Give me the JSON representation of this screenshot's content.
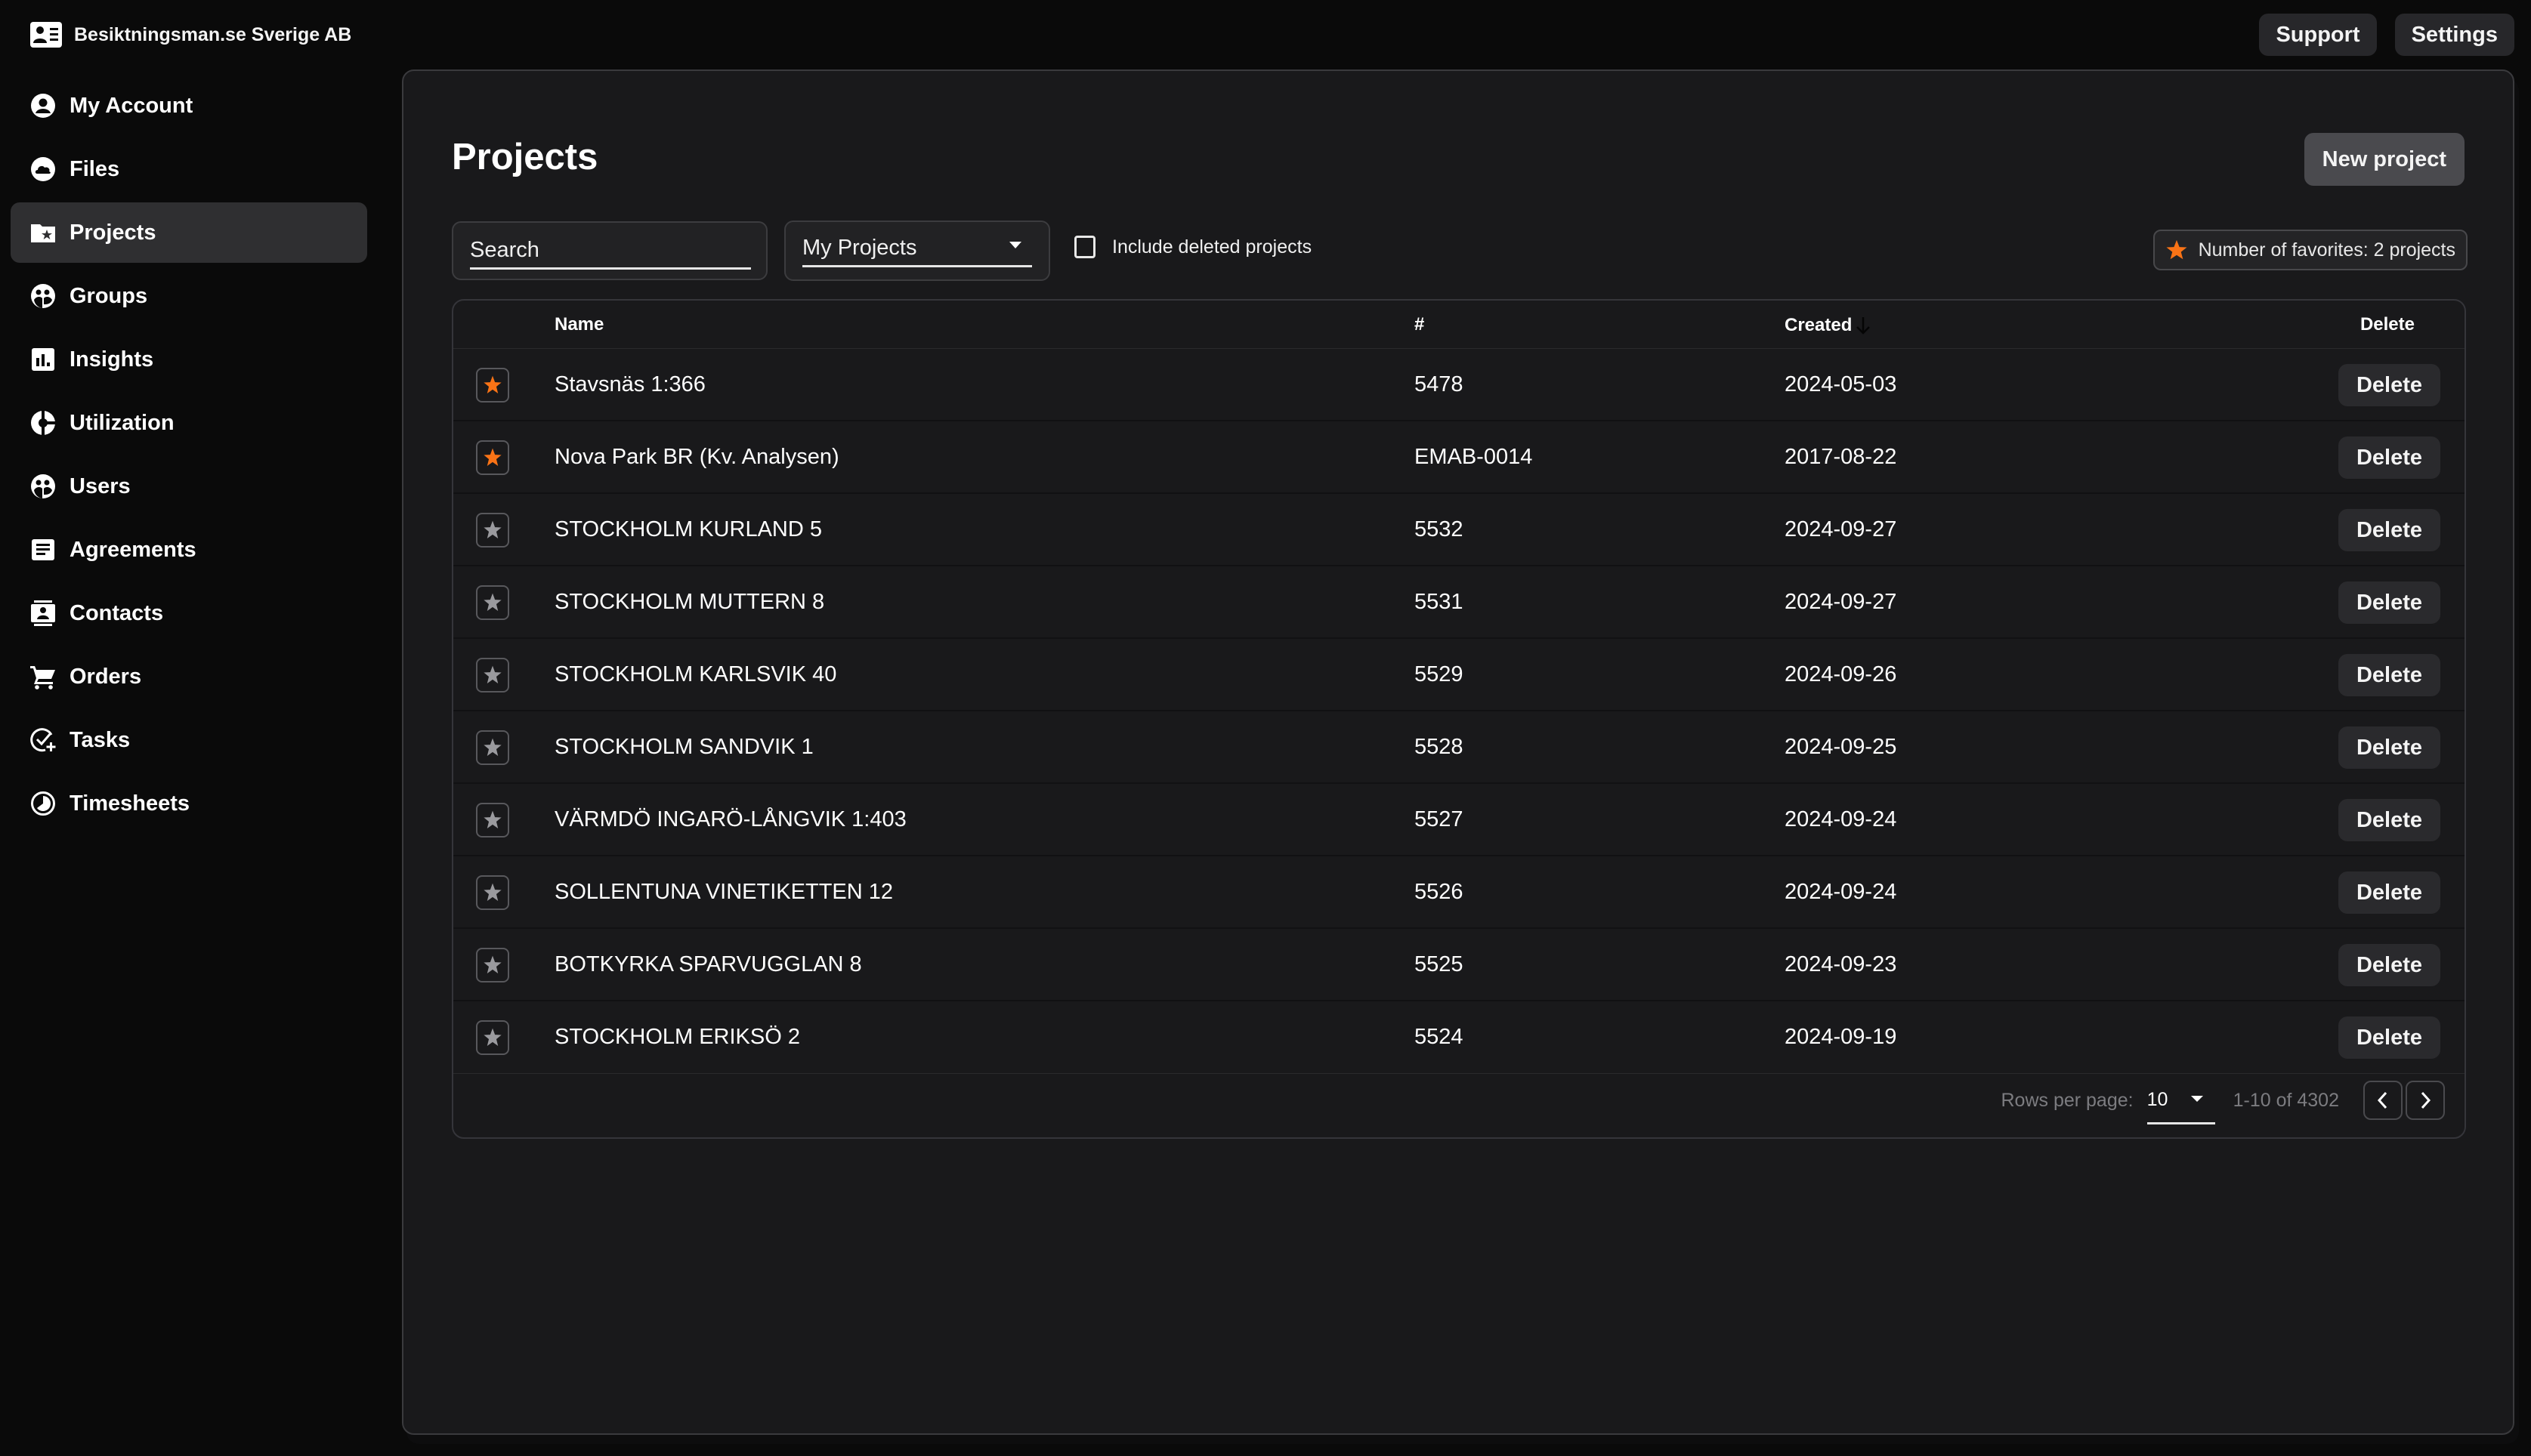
{
  "brand": {
    "name": "Besiktningsman.se Sverige AB",
    "icon": "contact-card-icon"
  },
  "sidebar": {
    "active": "Projects",
    "items": [
      {
        "label": "My Account",
        "icon": "account-circle-icon"
      },
      {
        "label": "Files",
        "icon": "cloud-icon"
      },
      {
        "label": "Projects",
        "icon": "folder-star-icon"
      },
      {
        "label": "Groups",
        "icon": "groups-icon"
      },
      {
        "label": "Insights",
        "icon": "bar-chart-icon"
      },
      {
        "label": "Utilization",
        "icon": "donut-chart-icon"
      },
      {
        "label": "Users",
        "icon": "users-icon"
      },
      {
        "label": "Agreements",
        "icon": "document-icon"
      },
      {
        "label": "Contacts",
        "icon": "contacts-icon"
      },
      {
        "label": "Orders",
        "icon": "cart-icon"
      },
      {
        "label": "Tasks",
        "icon": "task-add-icon"
      },
      {
        "label": "Timesheets",
        "icon": "clock-pie-icon"
      }
    ]
  },
  "topbar": {
    "support_label": "Support",
    "settings_label": "Settings"
  },
  "main": {
    "title": "Projects",
    "new_project_label": "New project",
    "search": {
      "placeholder": "Search",
      "value": ""
    },
    "filter": {
      "selected": "My Projects"
    },
    "include_deleted": {
      "label": "Include deleted projects",
      "checked": false
    },
    "favorites_badge": "Number of favorites: 2 projects",
    "colors": {
      "favorite": "#f97316",
      "not_favorite": "#9a9a9e"
    }
  },
  "table": {
    "columns": {
      "name": "Name",
      "number": "#",
      "created": "Created",
      "delete": "Delete"
    },
    "sort": {
      "column": "created",
      "direction": "desc"
    },
    "rows": [
      {
        "favorite": true,
        "name": "Stavsnäs 1:366",
        "number": "5478",
        "created": "2024-05-03",
        "delete_label": "Delete"
      },
      {
        "favorite": true,
        "name": "Nova Park BR (Kv. Analysen)",
        "number": "EMAB-0014",
        "created": "2017-08-22",
        "delete_label": "Delete"
      },
      {
        "favorite": false,
        "name": "STOCKHOLM KURLAND 5",
        "number": "5532",
        "created": "2024-09-27",
        "delete_label": "Delete"
      },
      {
        "favorite": false,
        "name": "STOCKHOLM MUTTERN 8",
        "number": "5531",
        "created": "2024-09-27",
        "delete_label": "Delete"
      },
      {
        "favorite": false,
        "name": "STOCKHOLM KARLSVIK 40",
        "number": "5529",
        "created": "2024-09-26",
        "delete_label": "Delete"
      },
      {
        "favorite": false,
        "name": "STOCKHOLM SANDVIK 1",
        "number": "5528",
        "created": "2024-09-25",
        "delete_label": "Delete"
      },
      {
        "favorite": false,
        "name": "VÄRMDÖ INGARÖ-LÅNGVIK 1:403",
        "number": "5527",
        "created": "2024-09-24",
        "delete_label": "Delete"
      },
      {
        "favorite": false,
        "name": "SOLLENTUNA VINETIKETTEN 12",
        "number": "5526",
        "created": "2024-09-24",
        "delete_label": "Delete"
      },
      {
        "favorite": false,
        "name": "BOTKYRKA SPARVUGGLAN 8",
        "number": "5525",
        "created": "2024-09-23",
        "delete_label": "Delete"
      },
      {
        "favorite": false,
        "name": "STOCKHOLM ERIKSÖ 2",
        "number": "5524",
        "created": "2024-09-19",
        "delete_label": "Delete"
      }
    ]
  },
  "pagination": {
    "rows_per_page_label": "Rows per page:",
    "rows_per_page": "10",
    "range": "1-10 of 4302"
  }
}
